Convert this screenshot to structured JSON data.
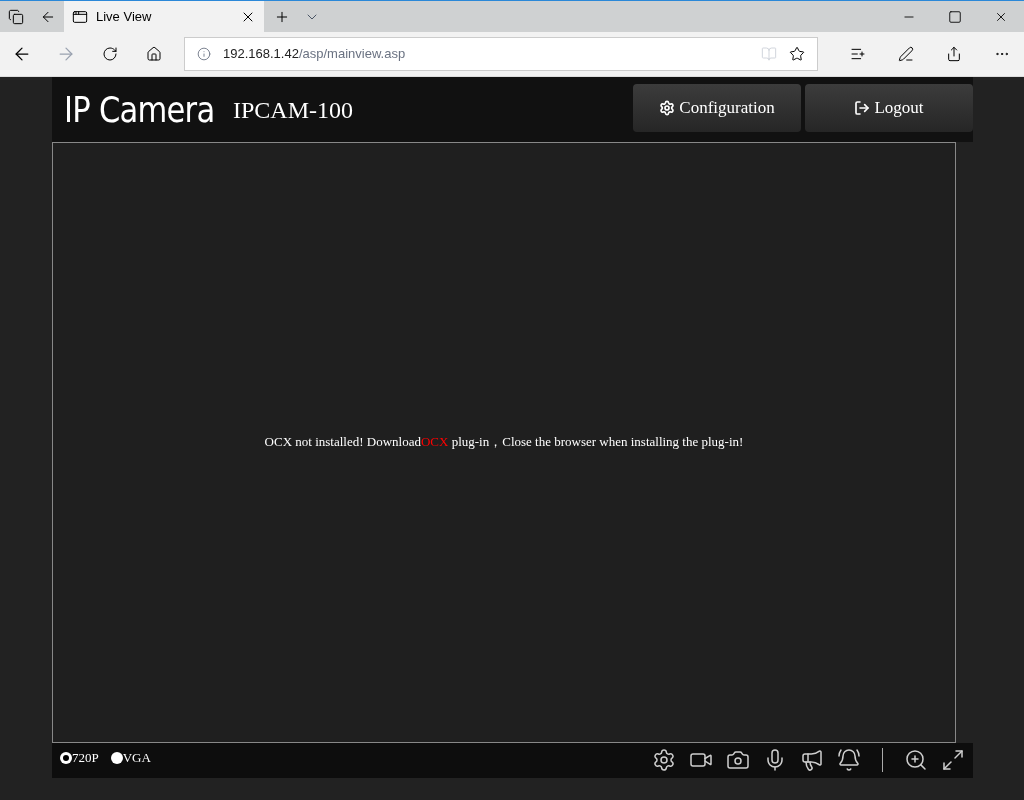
{
  "browser": {
    "tab_title": "Live View",
    "url_host": "192.168.1.42",
    "url_path": "/asp/mainview.asp"
  },
  "header": {
    "logo": "IP Camera",
    "model": "IPCAM-100",
    "buttons": [
      {
        "kind": "config",
        "label": "Configuration"
      },
      {
        "kind": "logout",
        "label": "Logout"
      }
    ]
  },
  "message": {
    "before": "OCX not installed! Download",
    "link": "OCX",
    "after": " plug-in，Close the browser when installing the plug-in!"
  },
  "resolutions": [
    {
      "label": "720P",
      "selected": true
    },
    {
      "label": "VGA",
      "selected": false
    }
  ]
}
